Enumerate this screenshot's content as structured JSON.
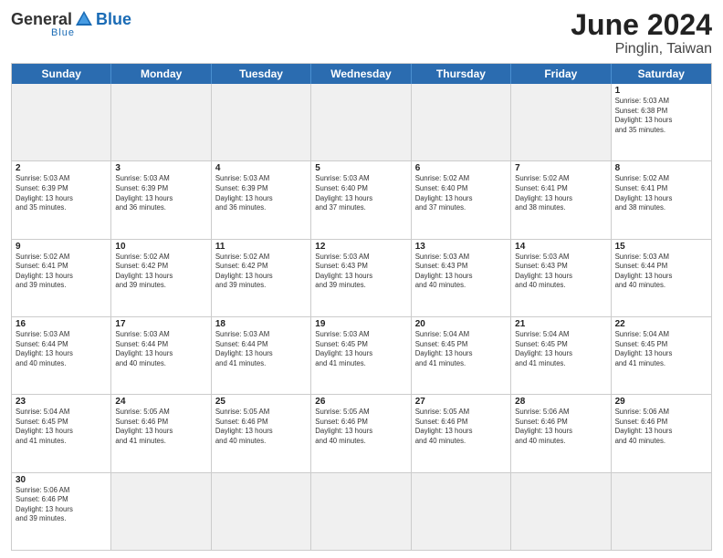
{
  "header": {
    "logo_general": "General",
    "logo_blue": "Blue",
    "logo_sub": "Blue",
    "month_title": "June 2024",
    "location": "Pinglin, Taiwan"
  },
  "weekdays": [
    "Sunday",
    "Monday",
    "Tuesday",
    "Wednesday",
    "Thursday",
    "Friday",
    "Saturday"
  ],
  "weeks": [
    [
      {
        "day": "",
        "info": "",
        "empty": true
      },
      {
        "day": "",
        "info": "",
        "empty": true
      },
      {
        "day": "",
        "info": "",
        "empty": true
      },
      {
        "day": "",
        "info": "",
        "empty": true
      },
      {
        "day": "",
        "info": "",
        "empty": true
      },
      {
        "day": "",
        "info": "",
        "empty": true
      },
      {
        "day": "1",
        "info": "Sunrise: 5:03 AM\nSunset: 6:38 PM\nDaylight: 13 hours\nand 35 minutes.",
        "empty": false
      }
    ],
    [
      {
        "day": "2",
        "info": "Sunrise: 5:03 AM\nSunset: 6:39 PM\nDaylight: 13 hours\nand 35 minutes.",
        "empty": false
      },
      {
        "day": "3",
        "info": "Sunrise: 5:03 AM\nSunset: 6:39 PM\nDaylight: 13 hours\nand 36 minutes.",
        "empty": false
      },
      {
        "day": "4",
        "info": "Sunrise: 5:03 AM\nSunset: 6:39 PM\nDaylight: 13 hours\nand 36 minutes.",
        "empty": false
      },
      {
        "day": "5",
        "info": "Sunrise: 5:03 AM\nSunset: 6:40 PM\nDaylight: 13 hours\nand 37 minutes.",
        "empty": false
      },
      {
        "day": "6",
        "info": "Sunrise: 5:02 AM\nSunset: 6:40 PM\nDaylight: 13 hours\nand 37 minutes.",
        "empty": false
      },
      {
        "day": "7",
        "info": "Sunrise: 5:02 AM\nSunset: 6:41 PM\nDaylight: 13 hours\nand 38 minutes.",
        "empty": false
      },
      {
        "day": "8",
        "info": "Sunrise: 5:02 AM\nSunset: 6:41 PM\nDaylight: 13 hours\nand 38 minutes.",
        "empty": false
      }
    ],
    [
      {
        "day": "9",
        "info": "Sunrise: 5:02 AM\nSunset: 6:41 PM\nDaylight: 13 hours\nand 39 minutes.",
        "empty": false
      },
      {
        "day": "10",
        "info": "Sunrise: 5:02 AM\nSunset: 6:42 PM\nDaylight: 13 hours\nand 39 minutes.",
        "empty": false
      },
      {
        "day": "11",
        "info": "Sunrise: 5:02 AM\nSunset: 6:42 PM\nDaylight: 13 hours\nand 39 minutes.",
        "empty": false
      },
      {
        "day": "12",
        "info": "Sunrise: 5:03 AM\nSunset: 6:43 PM\nDaylight: 13 hours\nand 39 minutes.",
        "empty": false
      },
      {
        "day": "13",
        "info": "Sunrise: 5:03 AM\nSunset: 6:43 PM\nDaylight: 13 hours\nand 40 minutes.",
        "empty": false
      },
      {
        "day": "14",
        "info": "Sunrise: 5:03 AM\nSunset: 6:43 PM\nDaylight: 13 hours\nand 40 minutes.",
        "empty": false
      },
      {
        "day": "15",
        "info": "Sunrise: 5:03 AM\nSunset: 6:44 PM\nDaylight: 13 hours\nand 40 minutes.",
        "empty": false
      }
    ],
    [
      {
        "day": "16",
        "info": "Sunrise: 5:03 AM\nSunset: 6:44 PM\nDaylight: 13 hours\nand 40 minutes.",
        "empty": false
      },
      {
        "day": "17",
        "info": "Sunrise: 5:03 AM\nSunset: 6:44 PM\nDaylight: 13 hours\nand 40 minutes.",
        "empty": false
      },
      {
        "day": "18",
        "info": "Sunrise: 5:03 AM\nSunset: 6:44 PM\nDaylight: 13 hours\nand 41 minutes.",
        "empty": false
      },
      {
        "day": "19",
        "info": "Sunrise: 5:03 AM\nSunset: 6:45 PM\nDaylight: 13 hours\nand 41 minutes.",
        "empty": false
      },
      {
        "day": "20",
        "info": "Sunrise: 5:04 AM\nSunset: 6:45 PM\nDaylight: 13 hours\nand 41 minutes.",
        "empty": false
      },
      {
        "day": "21",
        "info": "Sunrise: 5:04 AM\nSunset: 6:45 PM\nDaylight: 13 hours\nand 41 minutes.",
        "empty": false
      },
      {
        "day": "22",
        "info": "Sunrise: 5:04 AM\nSunset: 6:45 PM\nDaylight: 13 hours\nand 41 minutes.",
        "empty": false
      }
    ],
    [
      {
        "day": "23",
        "info": "Sunrise: 5:04 AM\nSunset: 6:45 PM\nDaylight: 13 hours\nand 41 minutes.",
        "empty": false
      },
      {
        "day": "24",
        "info": "Sunrise: 5:05 AM\nSunset: 6:46 PM\nDaylight: 13 hours\nand 41 minutes.",
        "empty": false
      },
      {
        "day": "25",
        "info": "Sunrise: 5:05 AM\nSunset: 6:46 PM\nDaylight: 13 hours\nand 40 minutes.",
        "empty": false
      },
      {
        "day": "26",
        "info": "Sunrise: 5:05 AM\nSunset: 6:46 PM\nDaylight: 13 hours\nand 40 minutes.",
        "empty": false
      },
      {
        "day": "27",
        "info": "Sunrise: 5:05 AM\nSunset: 6:46 PM\nDaylight: 13 hours\nand 40 minutes.",
        "empty": false
      },
      {
        "day": "28",
        "info": "Sunrise: 5:06 AM\nSunset: 6:46 PM\nDaylight: 13 hours\nand 40 minutes.",
        "empty": false
      },
      {
        "day": "29",
        "info": "Sunrise: 5:06 AM\nSunset: 6:46 PM\nDaylight: 13 hours\nand 40 minutes.",
        "empty": false
      }
    ],
    [
      {
        "day": "30",
        "info": "Sunrise: 5:06 AM\nSunset: 6:46 PM\nDaylight: 13 hours\nand 39 minutes.",
        "empty": false
      },
      {
        "day": "",
        "info": "",
        "empty": true
      },
      {
        "day": "",
        "info": "",
        "empty": true
      },
      {
        "day": "",
        "info": "",
        "empty": true
      },
      {
        "day": "",
        "info": "",
        "empty": true
      },
      {
        "day": "",
        "info": "",
        "empty": true
      },
      {
        "day": "",
        "info": "",
        "empty": true
      }
    ]
  ]
}
